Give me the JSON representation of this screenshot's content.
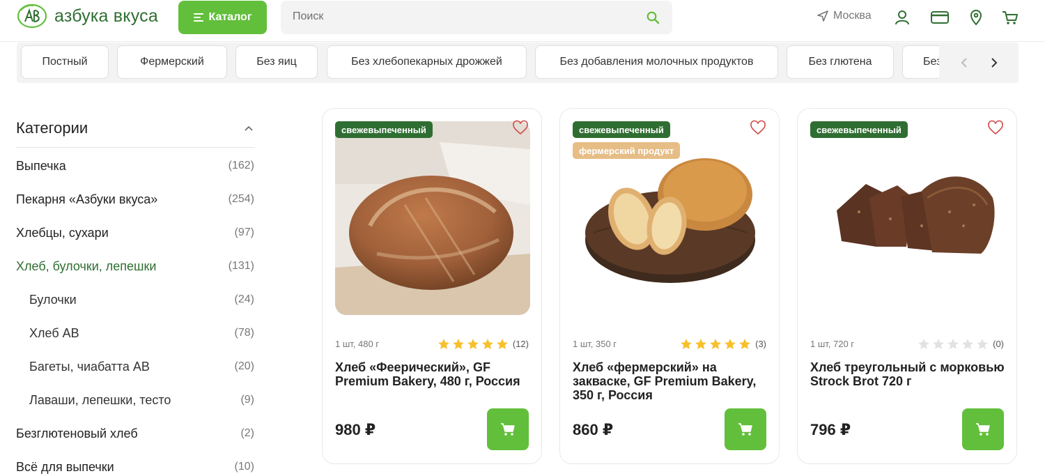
{
  "header": {
    "logo_text": "азбука вкуса",
    "catalog_label": "Каталог",
    "search_placeholder": "Поиск",
    "city": "Москва"
  },
  "chips": [
    "Постный",
    "Фермерский",
    "Без яиц",
    "Без хлебопекарных дрожжей",
    "Без добавления молочных продуктов",
    "Без глютена",
    "Без"
  ],
  "sidebar": {
    "title": "Категории",
    "items": [
      {
        "name": "Выпечка",
        "count": "(162)",
        "type": "top"
      },
      {
        "name": "Пекарня «Азбуки вкуса»",
        "count": "(254)",
        "type": "top"
      },
      {
        "name": "Хлебцы, сухари",
        "count": "(97)",
        "type": "top"
      },
      {
        "name": "Хлеб, булочки, лепешки",
        "count": "(131)",
        "type": "active"
      },
      {
        "name": "Булочки",
        "count": "(24)",
        "type": "sub"
      },
      {
        "name": "Хлеб AB",
        "count": "(78)",
        "type": "sub"
      },
      {
        "name": "Багеты, чиабатта AB",
        "count": "(20)",
        "type": "sub"
      },
      {
        "name": "Лаваши, лепешки, тесто",
        "count": "(9)",
        "type": "sub"
      },
      {
        "name": "Безглютеновый хлеб",
        "count": "(2)",
        "type": "top"
      },
      {
        "name": "Всё для выпечки",
        "count": "(10)",
        "type": "top"
      }
    ]
  },
  "products": [
    {
      "badges": [
        "свежевыпеченный"
      ],
      "weight": "1 шт, 480 г",
      "rating": 5,
      "reviews": "(12)",
      "title": "Хлеб «Феерический», GF Premium Bakery, 480 г, Россия",
      "price": "980 ₽"
    },
    {
      "badges": [
        "свежевыпеченный",
        "фермерский продукт"
      ],
      "weight": "1 шт, 350 г",
      "rating": 5,
      "reviews": "(3)",
      "title": "Хлеб «фермерский» на закваске, GF Premium Bakery, 350 г, Россия",
      "price": "860 ₽"
    },
    {
      "badges": [
        "свежевыпеченный"
      ],
      "weight": "1 шт, 720 г",
      "rating": 0,
      "reviews": "(0)",
      "title": "Хлеб треугольный с морковью Strock Brot 720 г",
      "price": "796 ₽"
    }
  ],
  "colors": {
    "brand_green": "#62bf3b",
    "dark_green": "#2f6e32",
    "star_gold": "#f7c02b",
    "star_empty": "#e2e2e2",
    "badge_tan": "#e7bd86"
  }
}
